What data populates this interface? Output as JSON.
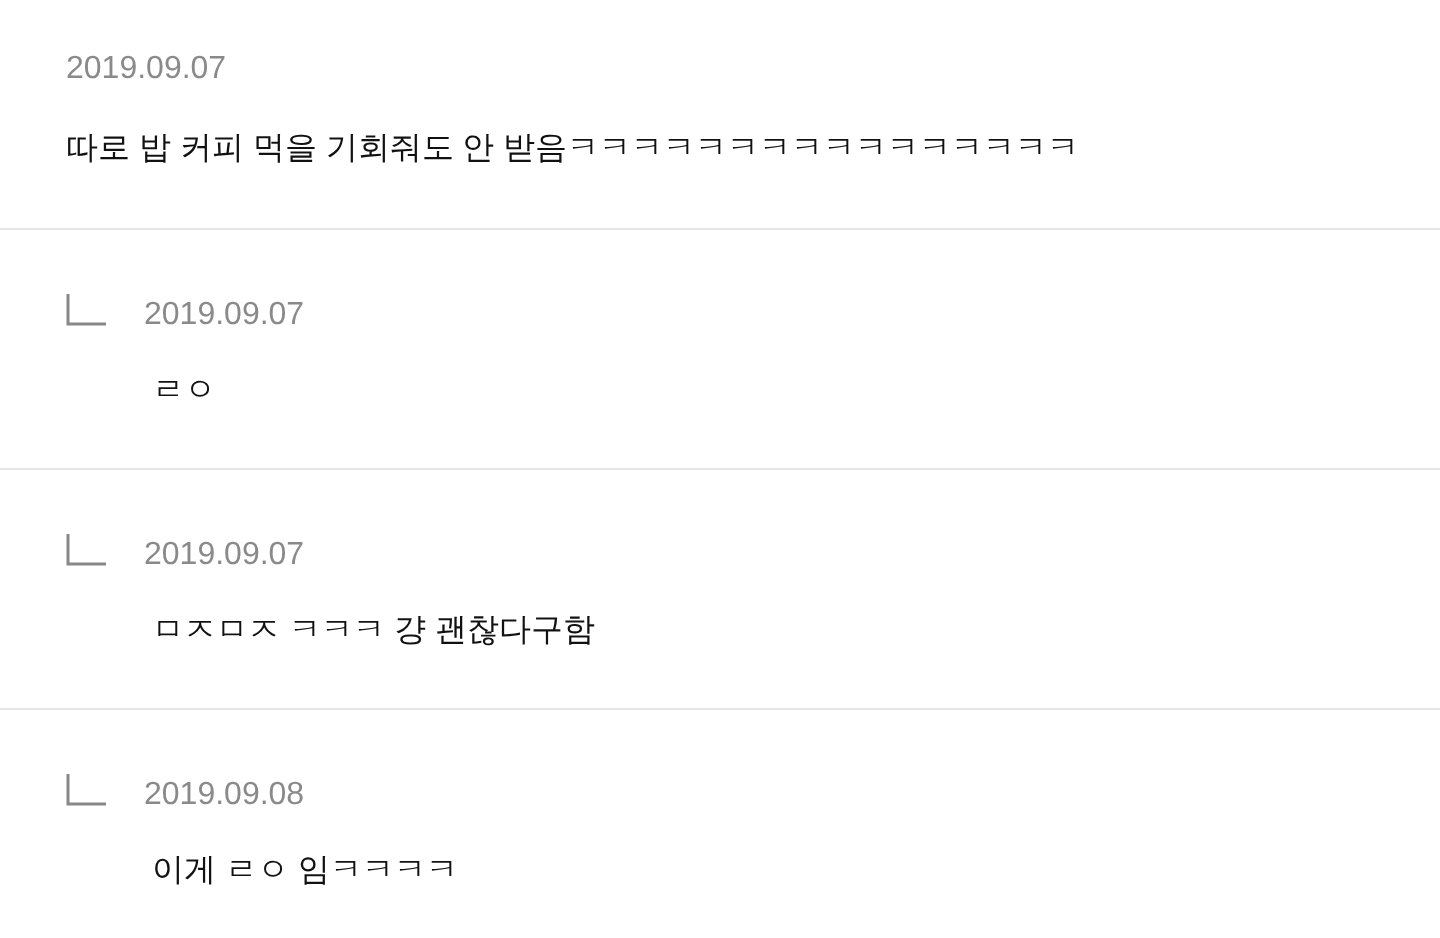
{
  "comment": {
    "date": "2019.09.07",
    "text": "따로 밥 커피 먹을 기회줘도 안 받음ㅋㅋㅋㅋㅋㅋㅋㅋㅋㅋㅋㅋㅋㅋㅋㅋ"
  },
  "replies": [
    {
      "date": "2019.09.07",
      "text": "ㄹㅇ"
    },
    {
      "date": "2019.09.07",
      "text": "ㅁㅈㅁㅈ ㅋㅋㅋ 걍 괜찮다구함"
    },
    {
      "date": "2019.09.08",
      "text": "이게 ㄹㅇ 임ㅋㅋㅋㅋ"
    }
  ]
}
